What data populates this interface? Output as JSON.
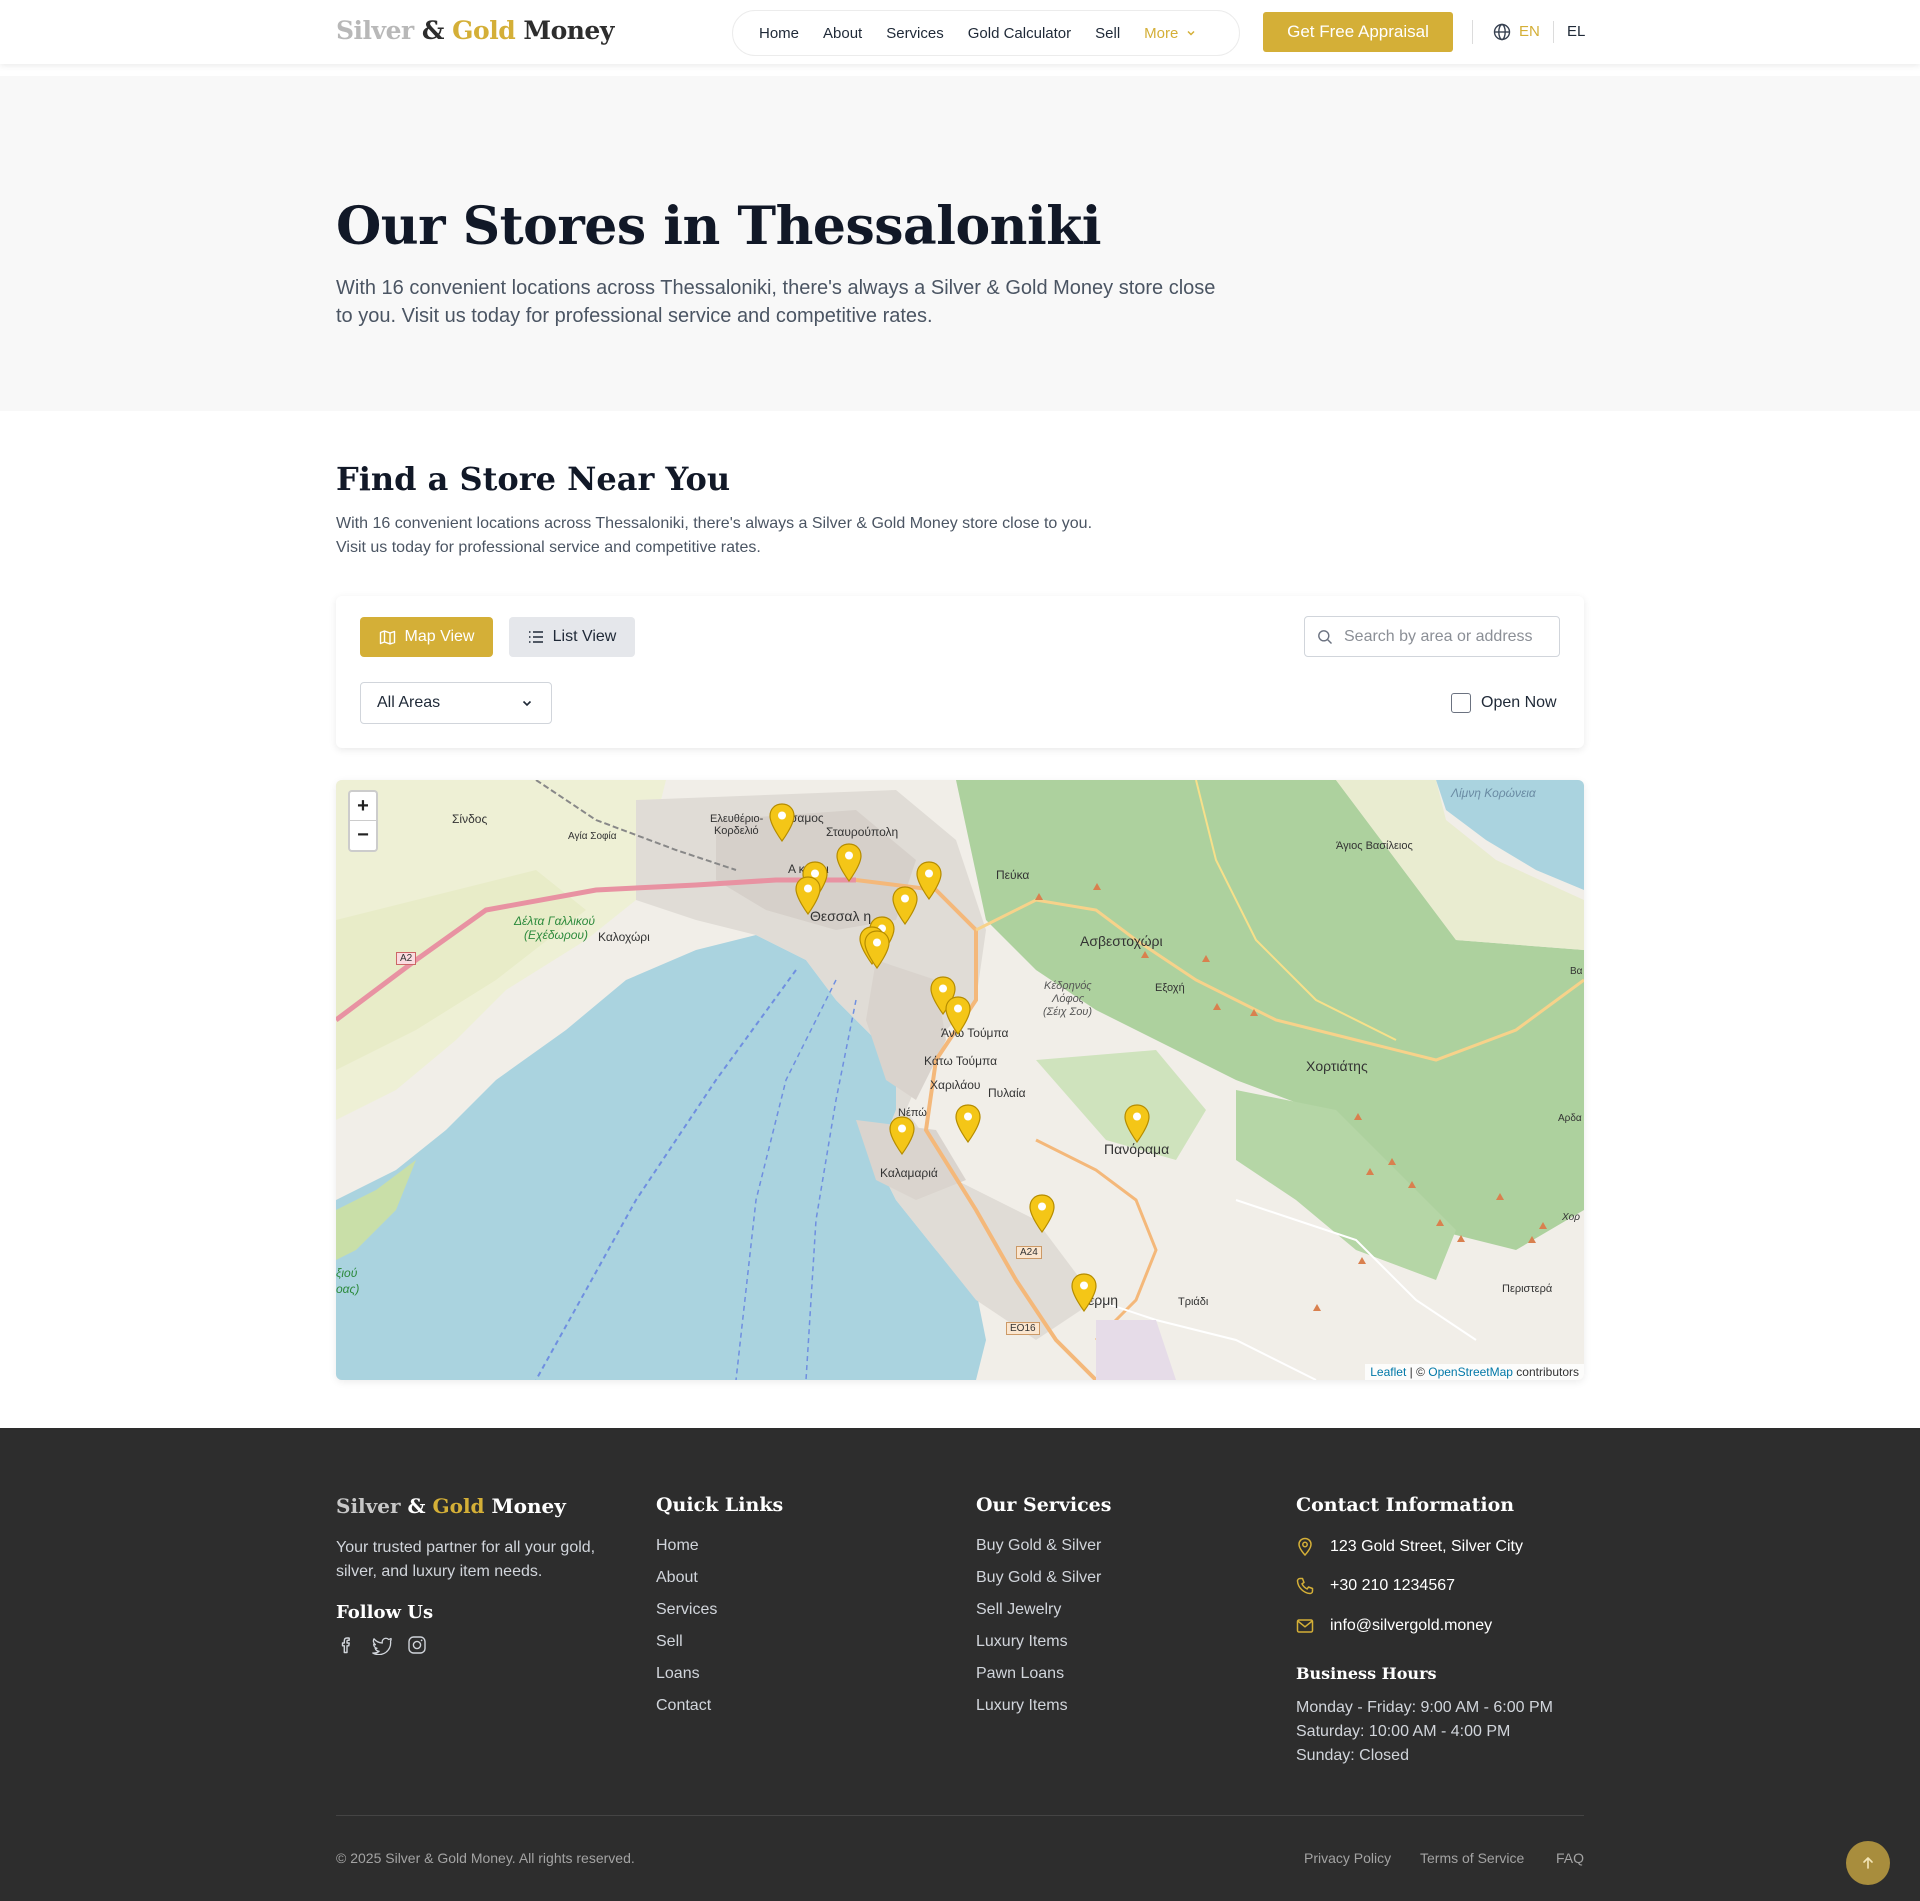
{
  "brand": {
    "silver": "Silver",
    "amp": "&",
    "gold": "Gold",
    "money": "Money"
  },
  "nav": {
    "items": [
      "Home",
      "About",
      "Services",
      "Gold Calculator",
      "Sell"
    ],
    "more": "More"
  },
  "cta_label": "Get Free Appraisal",
  "lang": {
    "en": "EN",
    "el": "EL"
  },
  "hero": {
    "title": "Our Stores in Thessaloniki",
    "subtitle": "With 16 convenient locations across Thessaloniki, there's always a Silver & Gold Money store close to you. Visit us today for professional service and competitive rates."
  },
  "finder": {
    "title": "Find a Store Near You",
    "description": "With 16 convenient locations across Thessaloniki, there's always a Silver & Gold Money store close to you. Visit us today for professional service and competitive rates.",
    "map_view_label": "Map View",
    "list_view_label": "List View",
    "search_placeholder": "Search by area or address",
    "area_select_value": "All Areas",
    "open_now_label": "Open Now"
  },
  "map": {
    "zoom_in": "+",
    "zoom_out": "−",
    "attribution": {
      "leaflet": "Leaflet",
      "sep": " | © ",
      "osm": "OpenStreetMap",
      "contributors": " contributors"
    },
    "labels": {
      "sindos": "Σίνδος",
      "agia_sofia": "Αγία Σοφία",
      "eleftherio": "Ελευθέριο-",
      "kordelio": "Κορδελιό",
      "stavroupoli": "Σταυρούπολη",
      "polichni": "σαμος",
      "ampelokipoi": "Α    κηποι",
      "peuka": "Πεύκα",
      "thessaloniki": "Θεσσαλ      η",
      "kalochori": "Καλοχώρι",
      "delta1": "Δέλτα Γαλλικού",
      "delta2": "(Εχέδωρου)",
      "asvestochori": "Ασβεστοχώρι",
      "kedrinos1": "Κέδρηνός",
      "kedrinos2": "Λόφος",
      "kedrinos3": "(Σέιχ Σου)",
      "exochi": "Εξοχή",
      "ano_toumba": "Άνω Τούμπα",
      "kato_toumba": "Κάτω Τούμπα",
      "charilaou": "Χαριλάου",
      "pylaia": "Πυλαία",
      "nea_elvetia": "Νέπώ",
      "kalamaria": "Καλαμαριά",
      "panorama": "Πανόραμα",
      "chortiatis": "Χορτιάτης",
      "koroneia": "Λίμνη Κορώνεια",
      "agios_vasileios": "Άγιος Βασίλειος",
      "trilofo": "Τριάδι",
      "peristera": "Περιστερά",
      "thermi": "έρμη",
      "axios1": "ξιού",
      "axios2": "οας)",
      "a2": "A2",
      "a24": "A24",
      "eo16": "ΕΟ16",
      "arda": "Αρδα",
      "ba": "Βα",
      "chor": "Χορ"
    },
    "store_count": 16
  },
  "footer": {
    "tagline": "Your trusted partner for all your gold, silver, and luxury item needs.",
    "follow_us": "Follow Us",
    "quick_links_title": "Quick Links",
    "quick_links": [
      "Home",
      "About",
      "Services",
      "Sell",
      "Loans",
      "Contact"
    ],
    "services_title": "Our Services",
    "services": [
      "Buy Gold & Silver",
      "Buy Gold & Silver",
      "Sell Jewelry",
      "Luxury Items",
      "Pawn Loans",
      "Luxury Items"
    ],
    "contact_title": "Contact Information",
    "address": "123 Gold Street, Silver City",
    "phone": "+30 210 1234567",
    "email": "info@silvergold.money",
    "hours_title": "Business Hours",
    "hours": [
      "Monday - Friday: 9:00 AM - 6:00 PM",
      "Saturday: 10:00 AM - 4:00 PM",
      "Sunday: Closed"
    ],
    "copyright": "© 2025 Silver & Gold Money. All rights reserved.",
    "legal": [
      "Privacy Policy",
      "Terms of Service",
      "FAQ"
    ]
  },
  "colors": {
    "gold": "#d4af37",
    "dark": "#2d2d2d",
    "hero_bg": "#f8f8f8",
    "sea": "#aad3df",
    "forest": "#add19e"
  },
  "icons": [
    "globe-icon",
    "chevron-down-icon",
    "map-icon",
    "list-icon",
    "search-icon",
    "map-pin-icon",
    "facebook-icon",
    "twitter-icon",
    "instagram-icon",
    "location-icon",
    "phone-icon",
    "mail-icon",
    "arrow-up-icon"
  ]
}
